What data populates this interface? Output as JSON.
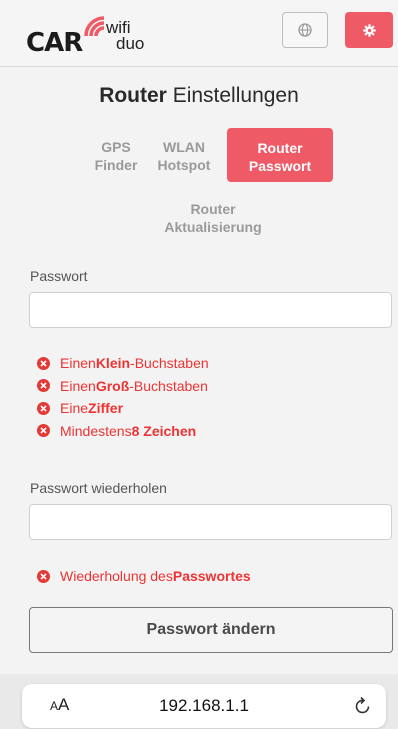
{
  "header": {
    "logo_car": "CAR",
    "logo_brand_top": "wifi",
    "logo_brand_bottom": "duo",
    "language_icon": "globe-icon",
    "settings_icon": "gear-icon"
  },
  "page": {
    "title_bold": "Router",
    "title_rest": " Einstellungen"
  },
  "tabs": [
    {
      "line1": "GPS",
      "line2": "Finder",
      "active": false
    },
    {
      "line1": "WLAN",
      "line2": "Hotspot",
      "active": false
    },
    {
      "line1": "Router",
      "line2": "Passwort",
      "active": true
    },
    {
      "line1": "Router",
      "line2": "Aktualisierung",
      "active": false
    }
  ],
  "form": {
    "password_label": "Passwort",
    "password_value": "",
    "rules": [
      {
        "prefix": "Einen ",
        "bold": "Klein",
        "suffix": "-Buchstaben"
      },
      {
        "prefix": "Einen ",
        "bold": "Groß",
        "suffix": "-Buchstaben"
      },
      {
        "prefix": "Eine ",
        "bold": "Ziffer",
        "suffix": ""
      },
      {
        "prefix": "Mindestens ",
        "bold": "8 Zeichen",
        "suffix": ""
      }
    ],
    "repeat_label": "Passwort wiederholen",
    "repeat_value": "",
    "repeat_rule": {
      "prefix": "Wiederholung des ",
      "bold": "Passwortes",
      "suffix": ""
    },
    "submit_label": "Passwort ändern"
  },
  "browser": {
    "text_size_small": "A",
    "text_size_large": "A",
    "url": "192.168.1.1",
    "reload_icon": "reload-icon"
  },
  "colors": {
    "accent": "#ee5a66",
    "error": "#e53935"
  }
}
